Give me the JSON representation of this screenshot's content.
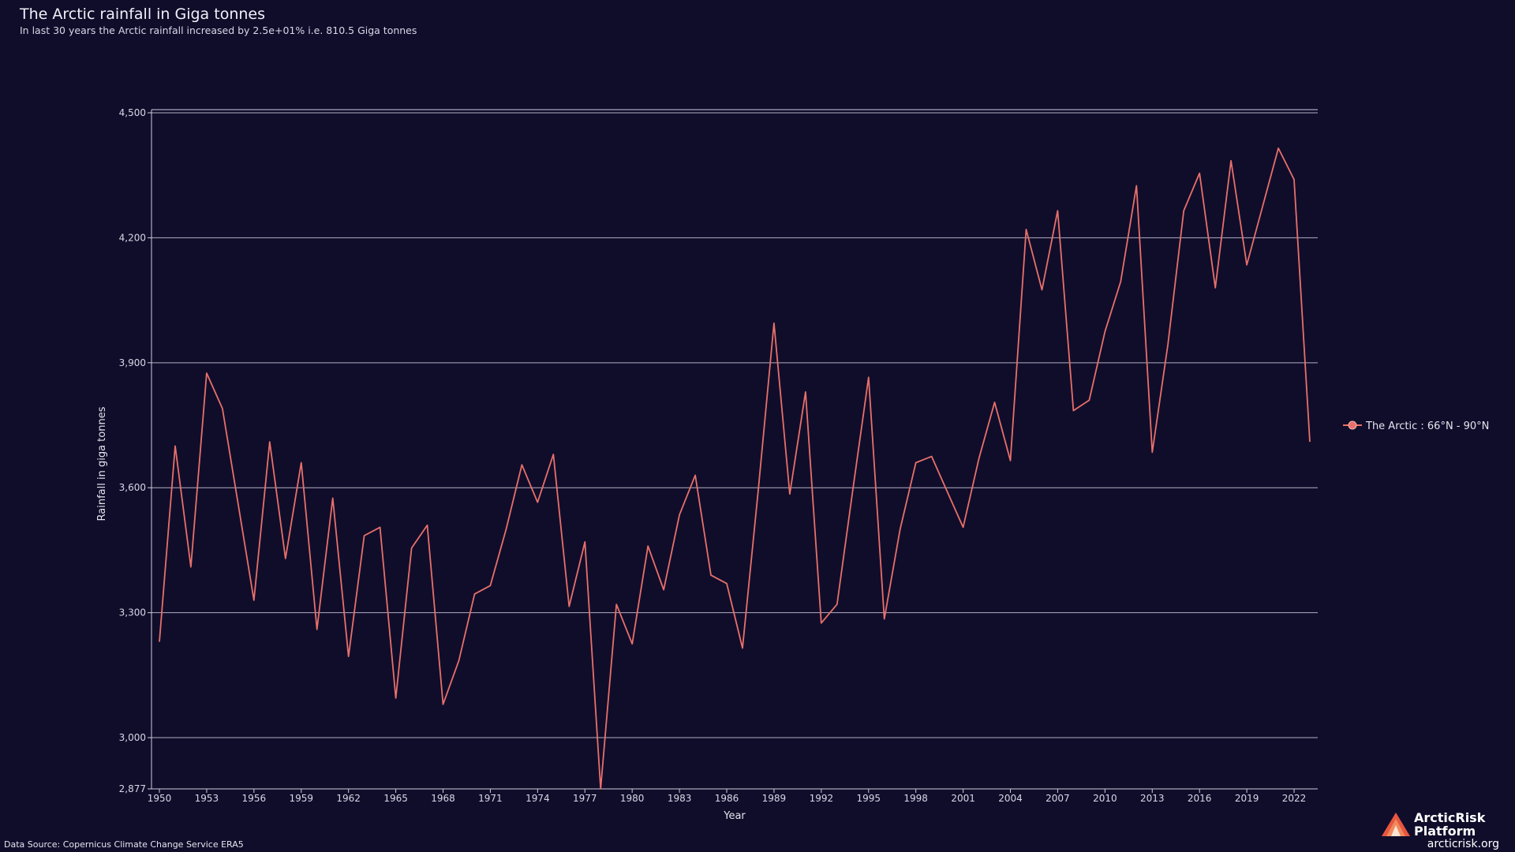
{
  "header": {
    "title": "The Arctic rainfall in Giga tonnes",
    "subtitle": "In last 30 years the Arctic rainfall increased by 2.5e+01% i.e. 810.5 Giga tonnes"
  },
  "footer": {
    "source": "Data Source: Copernicus Climate Change Service ERA5",
    "brand_name": "ArcticRisk Platform",
    "brand_url": "arcticrisk.org"
  },
  "colors": {
    "background": "#100d2b",
    "series": "#e8706a",
    "grid": "#cfcbdc",
    "brand_accent": "#e8563f"
  },
  "chart_data": {
    "type": "line",
    "title": "The Arctic rainfall in Giga tonnes",
    "xlabel": "Year",
    "ylabel": "Rainfall in giga tonnes",
    "xlim": [
      1950,
      2023
    ],
    "ylim": [
      2877,
      4500
    ],
    "y_ticks": [
      "2,877",
      "3,000",
      "3,300",
      "3,600",
      "3,900",
      "4,200",
      "4,500"
    ],
    "x_ticks": [
      "1950",
      "1953",
      "1956",
      "1959",
      "1962",
      "1965",
      "1968",
      "1971",
      "1974",
      "1977",
      "1980",
      "1983",
      "1986",
      "1989",
      "1992",
      "1995",
      "1998",
      "2001",
      "2004",
      "2007",
      "2010",
      "2013",
      "2016",
      "2019",
      "2022"
    ],
    "grid": "horizontal",
    "legend_position": "right",
    "series": [
      {
        "name": "The Arctic : 66°N - 90°N",
        "x": [
          1950,
          1951,
          1952,
          1953,
          1954,
          1955,
          1956,
          1957,
          1958,
          1959,
          1960,
          1961,
          1962,
          1963,
          1964,
          1965,
          1966,
          1967,
          1968,
          1969,
          1970,
          1971,
          1972,
          1973,
          1974,
          1975,
          1976,
          1977,
          1978,
          1979,
          1980,
          1981,
          1982,
          1983,
          1984,
          1985,
          1986,
          1987,
          1988,
          1989,
          1990,
          1991,
          1992,
          1993,
          1994,
          1995,
          1996,
          1997,
          1998,
          1999,
          2000,
          2001,
          2002,
          2003,
          2004,
          2005,
          2006,
          2007,
          2008,
          2009,
          2010,
          2011,
          2012,
          2013,
          2014,
          2015,
          2016,
          2017,
          2018,
          2019,
          2020,
          2021,
          2022,
          2023
        ],
        "y": [
          3230,
          3700,
          3410,
          3875,
          3790,
          3560,
          3330,
          3710,
          3430,
          3660,
          3260,
          3575,
          3195,
          3485,
          3505,
          3095,
          3455,
          3510,
          3080,
          3185,
          3345,
          3365,
          3500,
          3655,
          3565,
          3680,
          3315,
          3470,
          2877,
          3320,
          3225,
          3460,
          3355,
          3535,
          3630,
          3390,
          3370,
          3215,
          3595,
          3995,
          3585,
          3830,
          3275,
          3320,
          3595,
          3865,
          3285,
          3500,
          3660,
          3675,
          3590,
          3505,
          3670,
          3805,
          3665,
          4220,
          4075,
          4265,
          3785,
          3810,
          3975,
          4095,
          4325,
          3685,
          3945,
          4265,
          4355,
          4080,
          4385,
          4135,
          4275,
          4415,
          4340,
          3710
        ]
      }
    ]
  }
}
